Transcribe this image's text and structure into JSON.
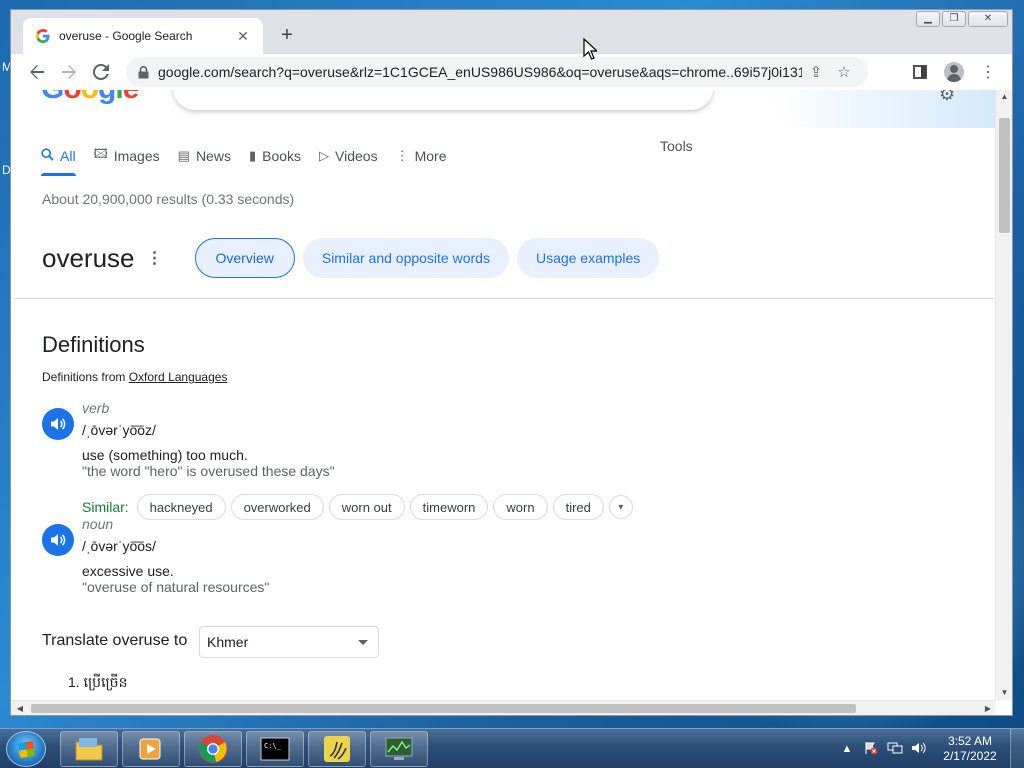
{
  "desktop": {
    "edge_letters": [
      "M",
      "D"
    ]
  },
  "browser": {
    "tab_title": "overuse - Google Search",
    "new_tab_symbol": "+",
    "url": "google.com/search?q=overuse&rlz=1C1GCEA_enUS986US986&oq=overuse&aqs=chrome..69i57j0i131i433i..."
  },
  "google": {
    "logo_letters": [
      "G",
      "o",
      "o",
      "g",
      "l",
      "e"
    ],
    "tabs": [
      {
        "label": "All",
        "icon": "search-icon"
      },
      {
        "label": "Images",
        "icon": "image-icon"
      },
      {
        "label": "News",
        "icon": "news-icon"
      },
      {
        "label": "Books",
        "icon": "book-icon"
      },
      {
        "label": "Videos",
        "icon": "play-icon"
      },
      {
        "label": "More",
        "icon": "more-vert-icon"
      }
    ],
    "tools_label": "Tools",
    "result_stats": "About 20,900,000 results (0.33 seconds)"
  },
  "dictionary": {
    "word": "overuse",
    "chips": [
      "Overview",
      "Similar and opposite words",
      "Usage examples"
    ],
    "definitions_title": "Definitions",
    "definitions_from_prefix": "Definitions from",
    "definitions_source": "Oxford Languages",
    "entries": [
      {
        "pos": "verb",
        "phonetic": "/ˌōvərˈyo͞oz/",
        "meaning": "use (something) too much.",
        "example": "\"the word \"hero\" is overused these days\""
      },
      {
        "pos": "noun",
        "phonetic": "/ˌōvərˈyo͞os/",
        "meaning": "excessive use.",
        "example": "\"overuse of natural resources\""
      }
    ],
    "similar_label": "Similar:",
    "similar_words": [
      "hackneyed",
      "overworked",
      "worn out",
      "timeworn",
      "worn",
      "tired"
    ],
    "translate_label": "Translate overuse to",
    "translate_language": "Khmer",
    "translation": "1. ប្រើច្រើន"
  },
  "taskbar": {
    "clock_time": "3:52 AM",
    "clock_date": "2/17/2022"
  },
  "colors": {
    "google_blue": "#1a73e8",
    "similar_green": "#188038",
    "chip_bg": "#e8f0fe"
  }
}
